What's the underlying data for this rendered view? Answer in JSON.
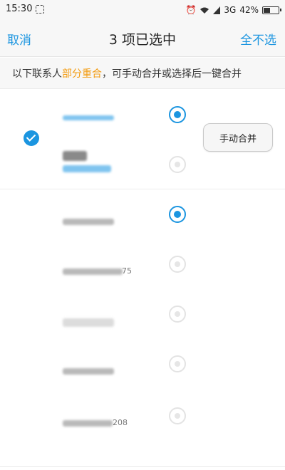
{
  "status_bar": {
    "time": "15:30",
    "network": "3G",
    "battery_percent": "42%",
    "battery_level": 0.42
  },
  "header": {
    "cancel_label": "取消",
    "title": "3 项已选中",
    "deselect_all_label": "全不选"
  },
  "banner": {
    "text_before": "以下联系人",
    "highlight": "部分重合",
    "text_after": "，可手动合并或选择后一键合并"
  },
  "group1": {
    "selected": true,
    "merge_button_label": "手动合并",
    "contacts": [
      {
        "selected": true
      },
      {
        "selected": false
      }
    ]
  },
  "contacts": [
    {
      "selected": true,
      "suffix": ""
    },
    {
      "selected": false,
      "suffix": "75"
    },
    {
      "selected": false,
      "suffix": ""
    },
    {
      "selected": false,
      "suffix": ""
    },
    {
      "selected": false,
      "suffix": "208"
    }
  ],
  "colors": {
    "accent": "#1b95e0",
    "highlight": "#f39c12"
  }
}
